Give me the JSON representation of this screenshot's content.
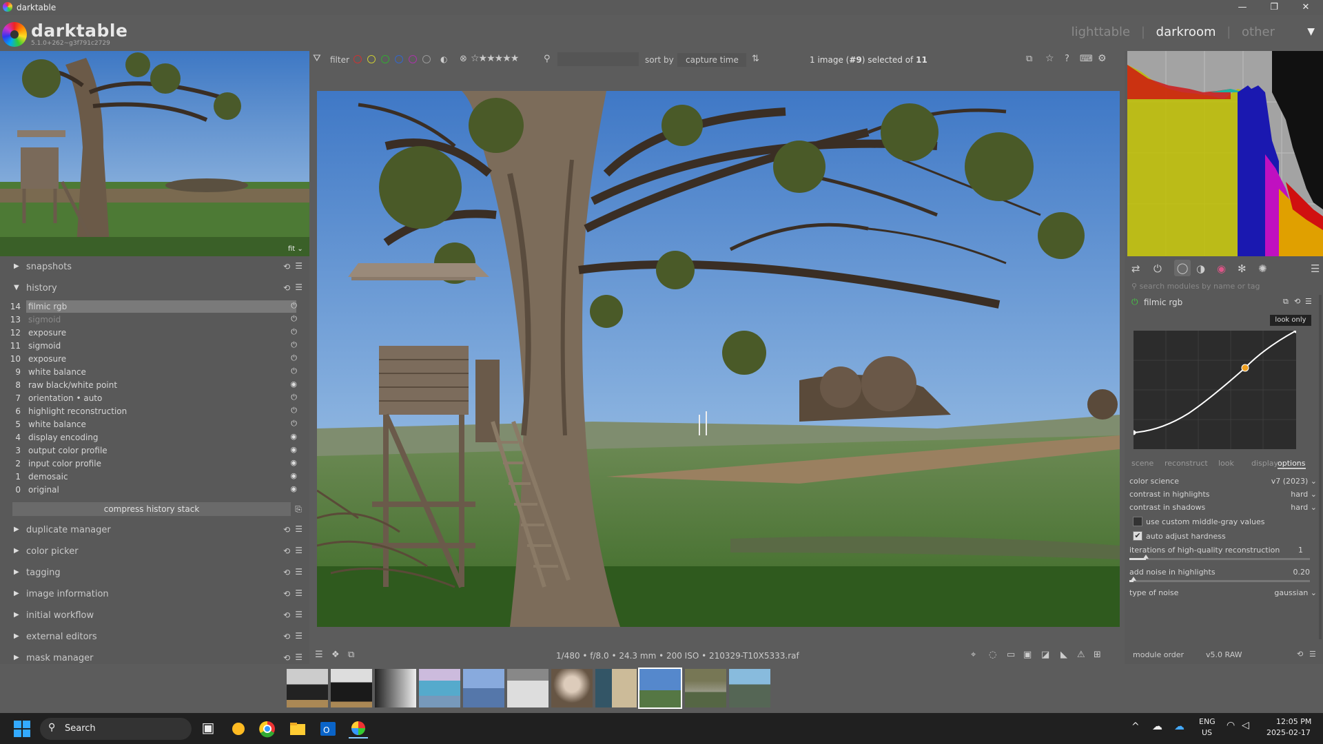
{
  "window": {
    "title": "darktable",
    "min": "—",
    "max": "❐",
    "close": "✕"
  },
  "header": {
    "app_name": "darktable",
    "version": "5.1.0+262~g3f791c2729",
    "views": [
      "lighttable",
      "darkroom",
      "other"
    ],
    "active_view": "darkroom",
    "sep": "|",
    "menu": "▼"
  },
  "left": {
    "fit_label": "fit ⌄",
    "snapshots": "snapshots",
    "history": {
      "title": "history",
      "items": [
        {
          "num": "14",
          "label": "filmic rgb",
          "sel": true,
          "disabled": false
        },
        {
          "num": "13",
          "label": "sigmoid",
          "sel": false,
          "disabled": true
        },
        {
          "num": "12",
          "label": "exposure",
          "sel": false,
          "disabled": false
        },
        {
          "num": "11",
          "label": "sigmoid",
          "sel": false,
          "disabled": false
        },
        {
          "num": "10",
          "label": "exposure",
          "sel": false,
          "disabled": false
        },
        {
          "num": "9",
          "label": "white balance",
          "sel": false,
          "disabled": false
        },
        {
          "num": "8",
          "label": "raw black/white point",
          "sel": false,
          "disabled": false
        },
        {
          "num": "7",
          "label": "orientation • auto",
          "sel": false,
          "disabled": false
        },
        {
          "num": "6",
          "label": "highlight reconstruction",
          "sel": false,
          "disabled": false
        },
        {
          "num": "5",
          "label": "white balance",
          "sel": false,
          "disabled": false
        },
        {
          "num": "4",
          "label": "display encoding",
          "sel": false,
          "disabled": false
        },
        {
          "num": "3",
          "label": "output color profile",
          "sel": false,
          "disabled": false
        },
        {
          "num": "2",
          "label": "input color profile",
          "sel": false,
          "disabled": false
        },
        {
          "num": "1",
          "label": "demosaic",
          "sel": false,
          "disabled": false
        },
        {
          "num": "0",
          "label": "original",
          "sel": false,
          "disabled": false
        }
      ],
      "compress": "compress history stack"
    },
    "sections": [
      "duplicate manager",
      "color picker",
      "tagging",
      "image information",
      "initial workflow",
      "external editors",
      "mask manager"
    ]
  },
  "toolbar": {
    "filter": "filter",
    "stars": "☆★★★★★",
    "sort_by": "sort by",
    "sort_value": "capture time",
    "count_pre": "1 image (",
    "count_num": "#9",
    "count_mid": ") selected of ",
    "count_total": "11"
  },
  "bottombar": {
    "exif": "1/480 • f/8.0 • 24.3 mm • 200 ISO • 210329-T10X5333.raf"
  },
  "right": {
    "search_placeholder": "search modules by name or tag",
    "module_name": "filmic rgb",
    "tooltip": "look only",
    "tabs": [
      "scene",
      "reconstruct",
      "look",
      "display",
      "options"
    ],
    "active_tab": "options",
    "options": [
      {
        "label": "color science",
        "value": "v7 (2023)  ⌄"
      },
      {
        "label": "contrast in highlights",
        "value": "hard  ⌄"
      },
      {
        "label": "contrast in shadows",
        "value": "hard  ⌄"
      }
    ],
    "checkbox1": "use custom middle-gray values",
    "checkbox2": "auto adjust hardness",
    "iterations_label": "iterations of high-quality reconstruction",
    "iterations_value": "1",
    "noise_label": "add noise in highlights",
    "noise_value": "0.20",
    "noise_type_label": "type of noise",
    "noise_type_value": "gaussian  ⌄",
    "module_order_label": "module order",
    "module_order_value": "v5.0 RAW"
  },
  "taskbar": {
    "search": "Search",
    "lang1": "ENG",
    "lang2": "US",
    "time": "12:05 PM",
    "date": "2025-02-17"
  }
}
